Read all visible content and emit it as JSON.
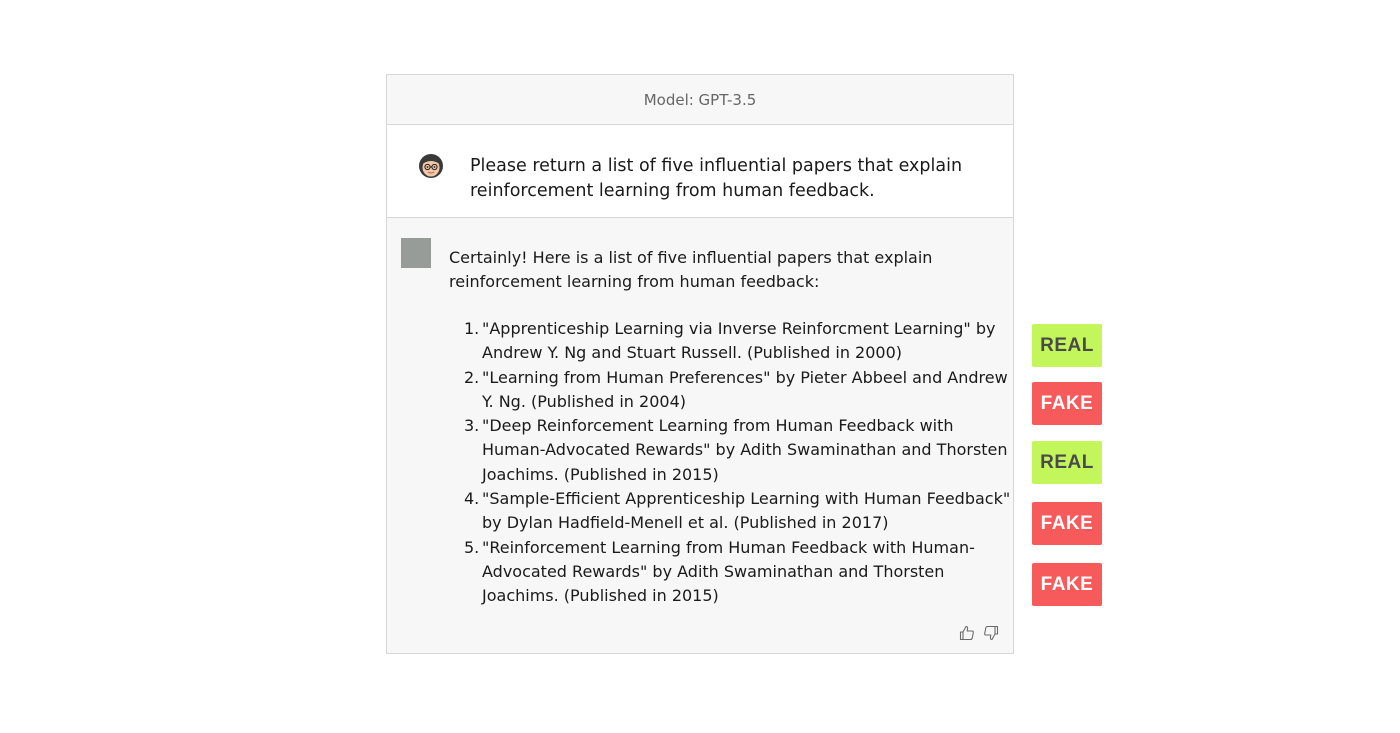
{
  "header": {
    "model_label": "Model: GPT-3.5"
  },
  "user": {
    "message": "Please return a list of five influential papers that explain reinforcement learning from human feedback."
  },
  "assistant": {
    "intro": "Certainly! Here is a list of five influential papers that explain reinforcement learning from human feedback:",
    "papers": [
      {
        "num": "1.",
        "text": "\"Apprenticeship Learning via Inverse Reinforcment Learning\" by Andrew Y. Ng and Stuart Russell. (Published in 2000)"
      },
      {
        "num": "2.",
        "text": "\"Learning from Human Preferences\" by Pieter Abbeel and Andrew Y. Ng. (Published in 2004)"
      },
      {
        "num": "3.",
        "text": "\"Deep Reinforcement Learning from Human Feedback with Human-Advocated Rewards\" by Adith Swaminathan and Thorsten Joachims. (Published in 2015)"
      },
      {
        "num": "4.",
        "text": "\"Sample-Efficient Apprenticeship Learning with Human Feedback\" by Dylan Hadfield-Menell et al. (Published in 2017)"
      },
      {
        "num": "5.",
        "text": "\"Reinforcement Learning from Human Feedback with Human-Advocated Rewards\" by Adith Swaminathan and Thorsten Joachims. (Published in 2015)"
      }
    ],
    "feedback_icons": [
      "thumbs-up-icon",
      "thumbs-down-icon"
    ]
  },
  "verdicts": [
    {
      "label": "REAL",
      "kind": "real",
      "color": "#c3f65a"
    },
    {
      "label": "FAKE",
      "kind": "fake",
      "color": "#f65a5a"
    },
    {
      "label": "REAL",
      "kind": "real",
      "color": "#c3f65a"
    },
    {
      "label": "FAKE",
      "kind": "fake",
      "color": "#f65a5a"
    },
    {
      "label": "FAKE",
      "kind": "fake",
      "color": "#f65a5a"
    }
  ]
}
